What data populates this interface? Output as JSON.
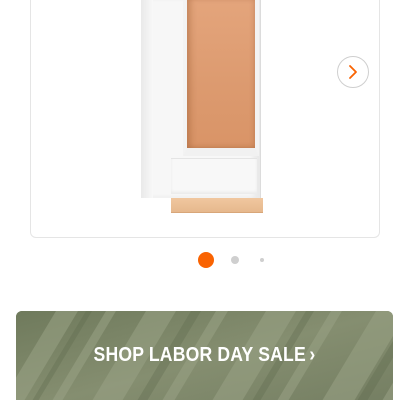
{
  "product_gallery": {
    "next_button_icon": "chevron-right-icon",
    "accent_color": "#f96302",
    "active_slide": 1,
    "slide_count": 3
  },
  "banner": {
    "label": "SHOP LABOR DAY SALE",
    "chevron": "›",
    "background_color": "#7d8668"
  }
}
